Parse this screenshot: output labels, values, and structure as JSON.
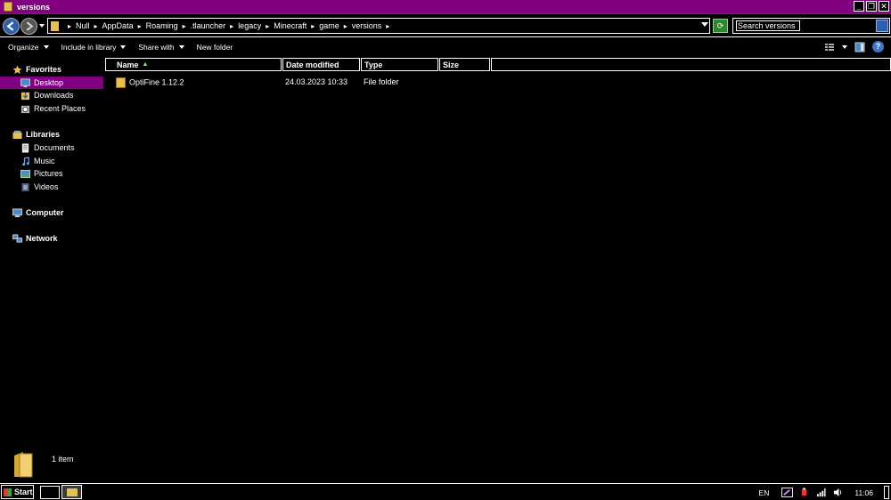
{
  "window": {
    "title": "versions",
    "accent": "#800080"
  },
  "address": {
    "crumbs": [
      "Null",
      "AppData",
      "Roaming",
      ".tlauncher",
      "legacy",
      "Minecraft",
      "game",
      "versions"
    ]
  },
  "search": {
    "placeholder": "Search versions"
  },
  "commands": {
    "organize": "Organize",
    "include": "Include in library",
    "share": "Share with",
    "newfolder": "New folder"
  },
  "nav": {
    "favorites": "Favorites",
    "desktop": "Desktop",
    "downloads": "Downloads",
    "recent": "Recent Places",
    "libraries": "Libraries",
    "documents": "Documents",
    "music": "Music",
    "pictures": "Pictures",
    "videos": "Videos",
    "computer": "Computer",
    "network": "Network"
  },
  "columns": {
    "name": "Name",
    "date": "Date modified",
    "type": "Type",
    "size": "Size"
  },
  "files": [
    {
      "name": "OptiFine 1.12.2",
      "date": "24.03.2023 10:33",
      "type": "File folder",
      "size": ""
    }
  ],
  "details": {
    "count": "1 item"
  },
  "taskbar": {
    "start": "Start",
    "lang": "EN",
    "time": "11:06"
  }
}
